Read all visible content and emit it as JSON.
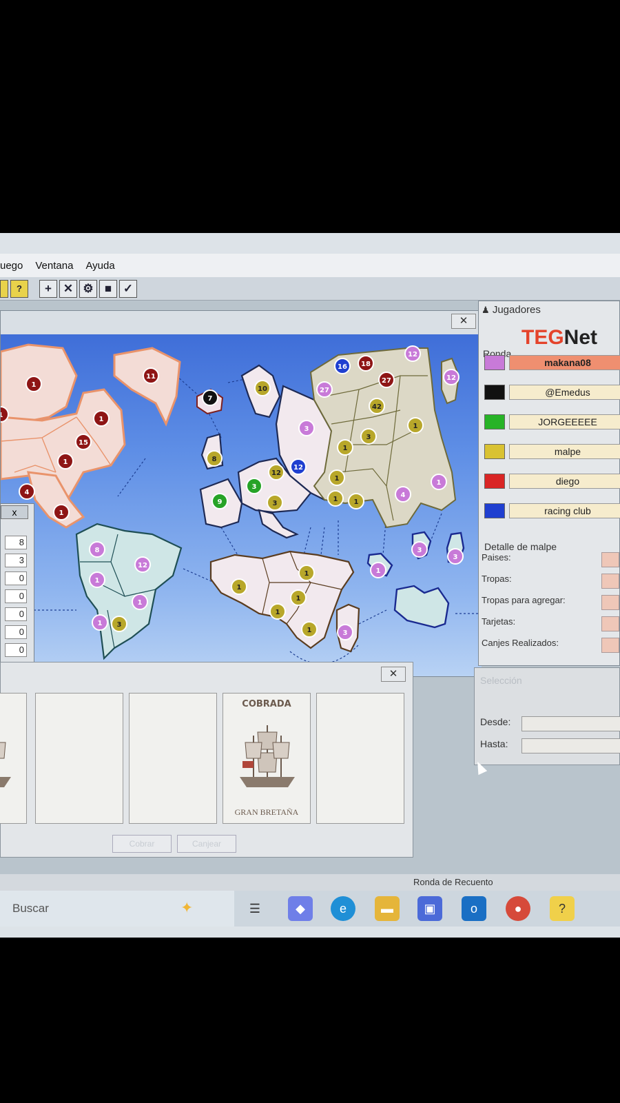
{
  "menu": {
    "items": [
      "uego",
      "Ventana",
      "Ayuda"
    ]
  },
  "toolbar": {
    "buttons": [
      "+",
      "✕",
      "⚙",
      "■",
      "✓"
    ]
  },
  "players_window": {
    "title": "Jugadores",
    "logo_a": "TEG",
    "logo_b": "Net",
    "ronda_label": "Ronda",
    "players": [
      {
        "name": "makana08",
        "color": "#c87ad8",
        "active": true
      },
      {
        "name": "@Emedus",
        "color": "#111111"
      },
      {
        "name": "JORGEEEEE",
        "color": "#27b327"
      },
      {
        "name": "malpe",
        "color": "#d9c232"
      },
      {
        "name": "diego",
        "color": "#d92525"
      },
      {
        "name": "racing club",
        "color": "#1f3fd0"
      }
    ],
    "detail_title": "Detalle de malpe",
    "detail_rows": [
      "Paises:",
      "Tropas:",
      "Tropas para agregar:",
      "Tarjetas:",
      "Canjes Realizados:"
    ]
  },
  "selection_window": {
    "title": "Selección",
    "from_label": "Desde:",
    "to_label": "Hasta:"
  },
  "stats_window": {
    "close": "x",
    "values": [
      "8",
      "3",
      "0",
      "0",
      "0",
      "0",
      "0"
    ]
  },
  "cards_window": {
    "cards": [
      {
        "title": "",
        "country": "NIA"
      },
      {
        "title": "",
        "country": ""
      },
      {
        "title": "",
        "country": ""
      },
      {
        "title": "COBRADA",
        "country": "GRAN BRETAÑA"
      },
      {
        "title": "",
        "country": ""
      }
    ],
    "buttons": [
      "Cobrar",
      "Canjear"
    ]
  },
  "statusbar": {
    "text": "Ronda de Recuento"
  },
  "taskbar": {
    "search": "Buscar"
  },
  "map": {
    "armies": [
      {
        "v": "1",
        "color": "#8e1515"
      },
      {
        "v": "11",
        "color": "#8e1515"
      },
      {
        "v": "1",
        "color": "#8e1515"
      },
      {
        "v": "1",
        "color": "#8e1515"
      },
      {
        "v": "15",
        "color": "#8e1515"
      },
      {
        "v": "1",
        "color": "#8e1515"
      },
      {
        "v": "4",
        "color": "#8e1515"
      },
      {
        "v": "1",
        "color": "#8e1515"
      },
      {
        "v": "7",
        "color": "#111111"
      },
      {
        "v": "10",
        "color": "#b8a72a"
      },
      {
        "v": "8",
        "color": "#b8a72a"
      },
      {
        "v": "9",
        "color": "#27a327"
      },
      {
        "v": "3",
        "color": "#27a327"
      },
      {
        "v": "12",
        "color": "#b8a72a"
      },
      {
        "v": "12",
        "color": "#1f3fd0"
      },
      {
        "v": "3",
        "color": "#b8a72a"
      },
      {
        "v": "3",
        "color": "#c87ad8"
      },
      {
        "v": "16",
        "color": "#1f3fd0"
      },
      {
        "v": "18",
        "color": "#8e1515"
      },
      {
        "v": "12",
        "color": "#c87ad8"
      },
      {
        "v": "27",
        "color": "#c87ad8"
      },
      {
        "v": "27",
        "color": "#8e1515"
      },
      {
        "v": "12",
        "color": "#c87ad8"
      },
      {
        "v": "42",
        "color": "#b8a72a"
      },
      {
        "v": "1",
        "color": "#b8a72a"
      },
      {
        "v": "3",
        "color": "#b8a72a"
      },
      {
        "v": "1",
        "color": "#b8a72a"
      },
      {
        "v": "1",
        "color": "#b8a72a"
      },
      {
        "v": "1",
        "color": "#b8a72a"
      },
      {
        "v": "1",
        "color": "#b8a72a"
      },
      {
        "v": "4",
        "color": "#c87ad8"
      },
      {
        "v": "1",
        "color": "#c87ad8"
      },
      {
        "v": "8",
        "color": "#c87ad8"
      },
      {
        "v": "12",
        "color": "#c87ad8"
      },
      {
        "v": "1",
        "color": "#c87ad8"
      },
      {
        "v": "1",
        "color": "#c87ad8"
      },
      {
        "v": "1",
        "color": "#c87ad8"
      },
      {
        "v": "3",
        "color": "#b8a72a"
      },
      {
        "v": "1",
        "color": "#b8a72a"
      },
      {
        "v": "1",
        "color": "#b8a72a"
      },
      {
        "v": "1",
        "color": "#b8a72a"
      },
      {
        "v": "1",
        "color": "#b8a72a"
      },
      {
        "v": "1",
        "color": "#b8a72a"
      },
      {
        "v": "3",
        "color": "#c87ad8"
      },
      {
        "v": "1",
        "color": "#c87ad8"
      },
      {
        "v": "3",
        "color": "#c87ad8"
      },
      {
        "v": "3",
        "color": "#c87ad8"
      }
    ]
  }
}
